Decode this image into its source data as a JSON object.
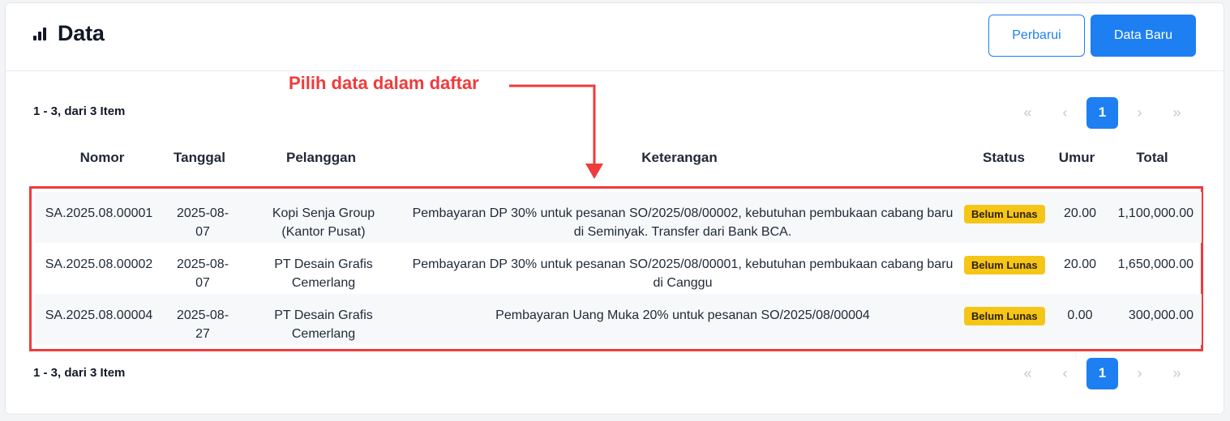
{
  "header": {
    "title": "Data",
    "refresh_label": "Perbarui",
    "new_label": "Data Baru"
  },
  "annotation": {
    "text": "Pilih data dalam daftar"
  },
  "pagination": {
    "range_text": "1 - 3, dari 3 Item",
    "first": "«",
    "prev": "‹",
    "current": "1",
    "next": "›",
    "last": "»"
  },
  "table": {
    "columns": [
      "Nomor",
      "Tanggal",
      "Pelanggan",
      "Keterangan",
      "Status",
      "Umur",
      "Total"
    ],
    "rows": [
      {
        "nomor": "SA.2025.08.00001",
        "tanggal": "2025-08-07",
        "pelanggan": "Kopi Senja Group (Kantor Pusat)",
        "keterangan": "Pembayaran DP 30% untuk pesanan SO/2025/08/00002, kebutuhan pembukaan cabang baru di Seminyak. Transfer dari Bank BCA.",
        "status": "Belum Lunas",
        "umur": "20.00",
        "total": "1,100,000.00"
      },
      {
        "nomor": "SA.2025.08.00002",
        "tanggal": "2025-08-07",
        "pelanggan": "PT Desain Grafis Cemerlang",
        "keterangan": "Pembayaran DP 30% untuk pesanan SO/2025/08/00001, kebutuhan pembukaan cabang baru di Canggu",
        "status": "Belum Lunas",
        "umur": "20.00",
        "total": "1,650,000.00"
      },
      {
        "nomor": "SA.2025.08.00004",
        "tanggal": "2025-08-27",
        "pelanggan": "PT Desain Grafis Cemerlang",
        "keterangan": "Pembayaran Uang Muka 20% untuk pesanan SO/2025/08/00004",
        "status": "Belum Lunas",
        "umur": "0.00",
        "total": "300,000.00"
      }
    ]
  },
  "colors": {
    "primary": "#1d7ff2",
    "annotation": "#ef3b3b",
    "badge": "#f5c518"
  }
}
